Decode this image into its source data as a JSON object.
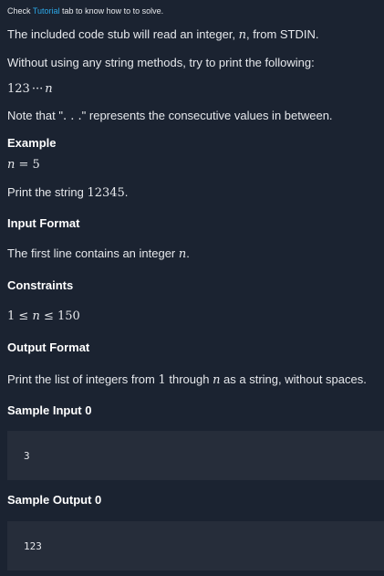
{
  "hint": {
    "prefix": "Check ",
    "link": "Tutorial",
    "suffix": " tab to know how to to solve."
  },
  "intro": {
    "line1_prefix": "The included code stub will read an integer, ",
    "line1_var": "n",
    "line1_suffix": ", from STDIN.",
    "line2": "Without using any string methods, try to print the following:",
    "formula_digits": "123",
    "formula_dots": "···",
    "formula_var": "n",
    "note_prefix": "Note that \"",
    "note_math": ". . .",
    "note_suffix": "\" represents the consecutive values in between."
  },
  "example": {
    "heading": "Example",
    "eq_var": "n",
    "eq_rest": "= 5",
    "text_prefix": "Print the string ",
    "text_value": "12345",
    "text_suffix": "."
  },
  "input_format": {
    "heading": "Input Format",
    "text_prefix": "The first line contains an integer ",
    "text_var": "n",
    "text_suffix": "."
  },
  "constraints": {
    "heading": "Constraints",
    "left": "1 ≤ ",
    "var": "n",
    "right": " ≤ 150"
  },
  "output_format": {
    "heading": "Output Format",
    "text_prefix": "Print the list of integers from ",
    "text_one": "1",
    "text_mid": " through ",
    "text_var": "n",
    "text_suffix": " as a string, without spaces."
  },
  "sample_input": {
    "heading": "Sample Input 0",
    "value": "3"
  },
  "sample_output": {
    "heading": "Sample Output 0",
    "value": "123"
  },
  "colors": {
    "background": "#1b2331",
    "code_background": "#262d3a",
    "link": "#2ca8e8"
  }
}
